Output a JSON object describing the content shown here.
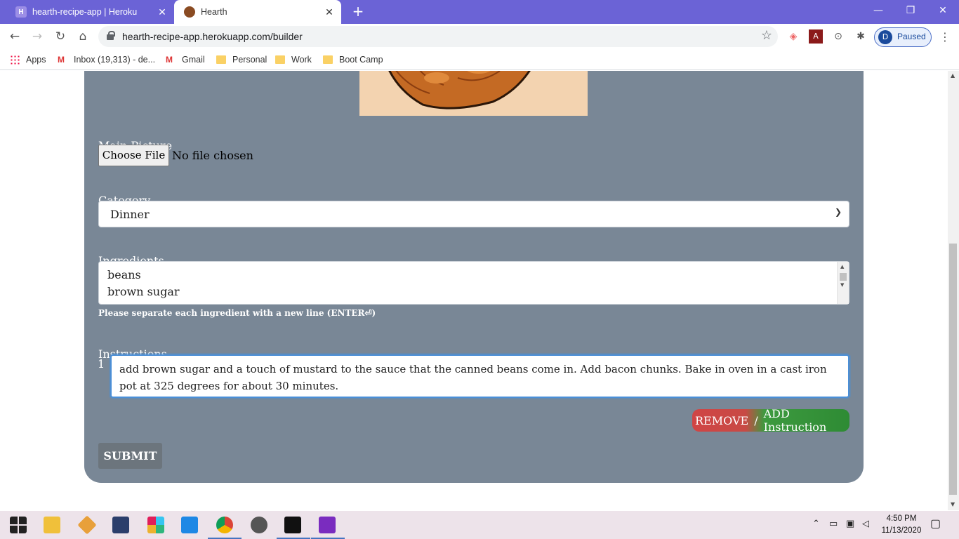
{
  "browser": {
    "tabs": [
      {
        "title": "hearth-recipe-app | Heroku",
        "favicon": "H",
        "active": false
      },
      {
        "title": "Hearth",
        "favicon": "",
        "active": true
      }
    ],
    "url": "hearth-recipe-app.herokuapp.com/builder",
    "profile_initial": "D",
    "profile_status": "Paused",
    "bookmarks": [
      {
        "label": "Apps",
        "icon": "apps-grid-icon"
      },
      {
        "label": "Inbox (19,313) - de...",
        "icon": "gmail-icon"
      },
      {
        "label": "Gmail",
        "icon": "gmail-icon"
      },
      {
        "label": "Personal",
        "icon": "folder-icon"
      },
      {
        "label": "Work",
        "icon": "folder-icon"
      },
      {
        "label": "Boot Camp",
        "icon": "folder-icon"
      }
    ]
  },
  "form": {
    "main_picture_label": "Main Picture",
    "choose_file_label": "Choose File",
    "file_status": "No file chosen",
    "category_label": "Category",
    "category_value": "Dinner",
    "ingredients_label": "Ingredients",
    "ingredients": [
      "beans",
      "brown sugar"
    ],
    "ingredients_hint": "Please separate each ingredient with a new line (ENTER⏎)",
    "instructions_label": "Instructions",
    "instructions": [
      {
        "number": "1",
        "text": "add brown sugar and a touch of mustard to the sauce that the canned beans come in.  Add bacon chunks. Bake in oven in a cast iron pot at 325 degrees for about 30 minutes."
      }
    ],
    "remove_label": "REMOVE",
    "separator": "/",
    "add_label": "ADD Instruction",
    "submit_label": "SUBMIT"
  },
  "colors": {
    "card_bg": "#798796",
    "remove": "#d04545",
    "add": "#2e8b34",
    "submit": "#6c757d",
    "tabbar": "#6b63d6"
  },
  "taskbar": {
    "time": "4:50 PM",
    "date": "11/13/2020"
  }
}
